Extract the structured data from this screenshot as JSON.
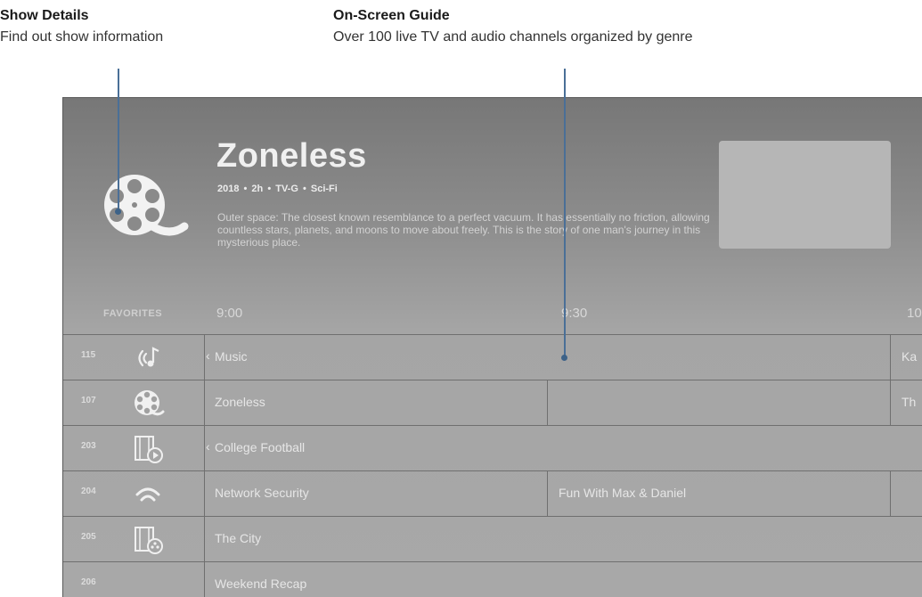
{
  "callouts": {
    "show_details": {
      "title": "Show Details",
      "desc": "Find out show information"
    },
    "guide": {
      "title": "On-Screen Guide",
      "desc": "Over 100 live TV and audio channels organized by genre"
    }
  },
  "details": {
    "title": "Zoneless",
    "meta": "2018  •  2h  •  TV-G  •  Sci-Fi",
    "description": "Outer space: The closest known resemblance to a perfect vacuum. It has essentially no friction, allowing countless stars, planets, and moons to move about freely. This is the story of one man's journey in this mysterious place.",
    "icon": "film-reel-icon"
  },
  "guide": {
    "favorites_label": "FAVORITES",
    "times": [
      "9:00",
      "9:30",
      "10"
    ],
    "rows": [
      {
        "channel": "115",
        "icon": "music-icon",
        "cells": [
          {
            "title": "Music",
            "arrow": "‹"
          },
          {
            "title": "Ka"
          }
        ]
      },
      {
        "channel": "107",
        "icon": "film-reel-icon",
        "cells": [
          {
            "title": "Zoneless"
          },
          {
            "title": ""
          },
          {
            "title": "Th"
          }
        ]
      },
      {
        "channel": "203",
        "icon": "film-play-icon",
        "cells": [
          {
            "title": "College Football",
            "arrow": "‹"
          }
        ]
      },
      {
        "channel": "204",
        "icon": "wifi-icon",
        "cells": [
          {
            "title": "Network Security"
          },
          {
            "title": "Fun With Max & Daniel"
          },
          {
            "title": ""
          }
        ]
      },
      {
        "channel": "205",
        "icon": "film-disc-icon",
        "cells": [
          {
            "title": "The City"
          }
        ]
      },
      {
        "channel": "206",
        "icon": "",
        "cells": [
          {
            "title": "Weekend Recap"
          }
        ]
      }
    ]
  },
  "colors": {
    "leader": "#4a6f97",
    "screen_top": "#777777",
    "screen_bottom": "#a8a8a8"
  }
}
